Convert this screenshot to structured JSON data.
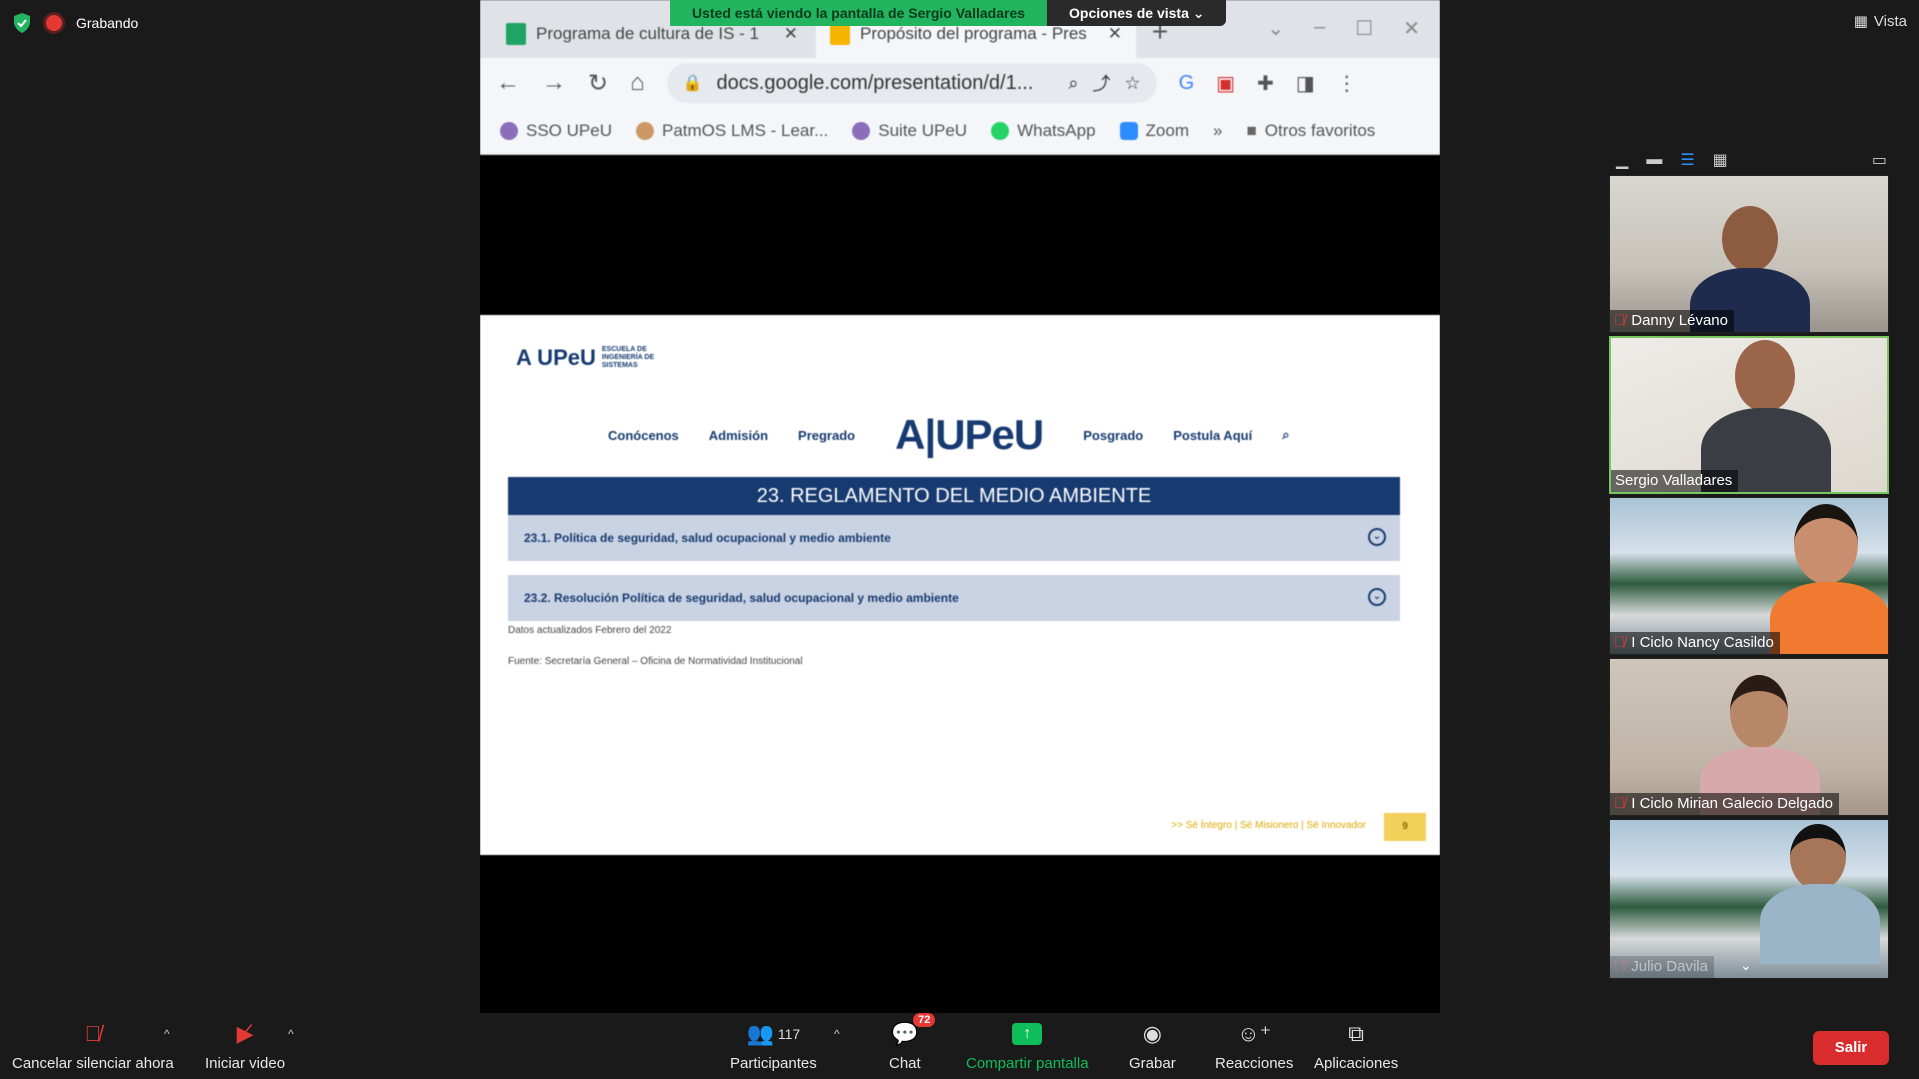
{
  "top": {
    "recording_label": "Grabando",
    "view_label": "Vista"
  },
  "share_banner": {
    "viewing_text": "Usted está viendo la pantalla de Sergio Valladares",
    "view_options_label": "Opciones de vista"
  },
  "browser": {
    "tabs": [
      {
        "title": "Programa de cultura de IS - 1"
      },
      {
        "title": "Propósito del programa - Pres"
      }
    ],
    "url": "docs.google.com/presentation/d/1...",
    "bookmarks": [
      {
        "label": "SSO UPeU",
        "icon": "upeu-icon",
        "color": "#8a6fb8"
      },
      {
        "label": "PatmOS LMS - Lear...",
        "icon": "upeu-icon",
        "color": "#c96"
      },
      {
        "label": "Suite UPeU",
        "icon": "upeu-icon",
        "color": "#8a6fb8"
      },
      {
        "label": "WhatsApp",
        "icon": "whatsapp-icon",
        "color": "#25d366"
      },
      {
        "label": "Zoom",
        "icon": "zoom-icon",
        "color": "#2d8cff"
      }
    ],
    "other_favorites": "Otros favoritos"
  },
  "slide": {
    "logo_text": "A UPeU",
    "logo_sub": "ESCUELA DE INGENIERÍA DE SISTEMAS",
    "nav": [
      "Conócenos",
      "Admisión",
      "Pregrado",
      "Posgrado",
      "Postula Aquí"
    ],
    "brand": "UPeU",
    "title": "23. REGLAMENTO DEL MEDIO AMBIENTE",
    "items": [
      "23.1. Política de seguridad, salud ocupacional y medio ambiente",
      "23.2. Resolución Política de seguridad, salud ocupacional y medio ambiente"
    ],
    "note1": "Datos actualizados Febrero del 2022",
    "note2": "Fuente: Secretaría General – Oficina de Normatividad Institucional",
    "footer": ">> Sé Íntegro | Sé Misionero | Sé Innovador",
    "page": "9"
  },
  "participants": [
    {
      "name": "Danny Lévano",
      "muted": true
    },
    {
      "name": "Sergio Valladares",
      "muted": false,
      "speaking": true
    },
    {
      "name": "I Ciclo Nancy Casildo",
      "muted": true
    },
    {
      "name": "I Ciclo Mirian Galecio Delgado",
      "muted": true
    },
    {
      "name": "Julio Davila",
      "muted": true
    }
  ],
  "toolbar": {
    "unmute_label": "Cancelar silenciar ahora",
    "video_label": "Iniciar video",
    "participants_label": "Participantes",
    "participants_count": "117",
    "chat_label": "Chat",
    "chat_badge": "72",
    "share_label": "Compartir pantalla",
    "record_label": "Grabar",
    "reactions_label": "Reacciones",
    "apps_label": "Aplicaciones",
    "leave_label": "Salir"
  }
}
